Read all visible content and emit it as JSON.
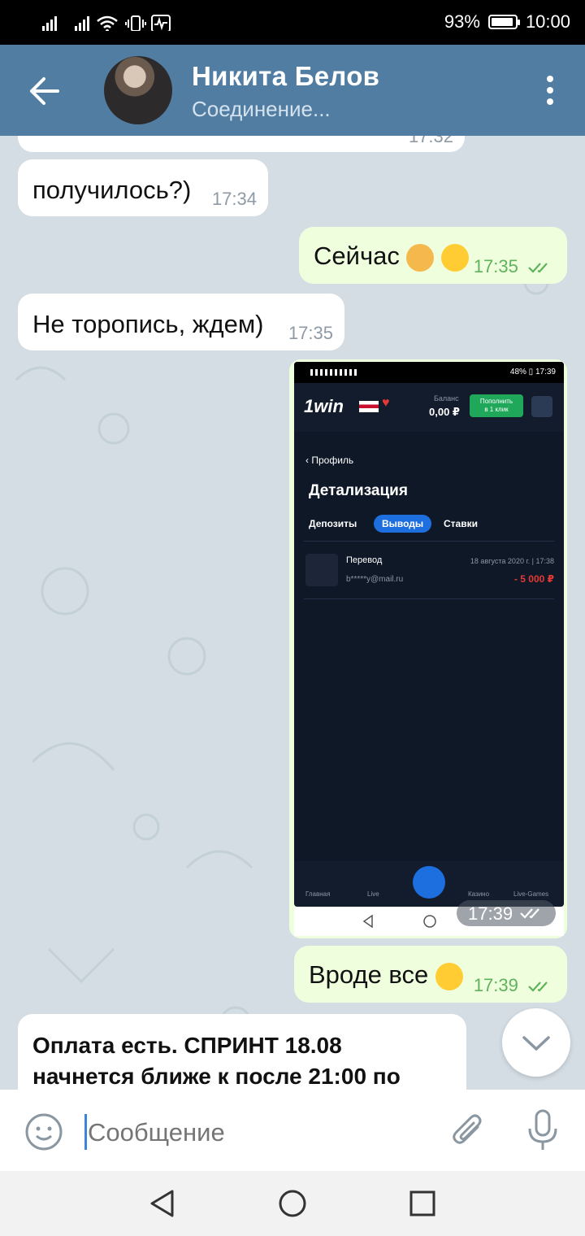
{
  "status_bar": {
    "battery": "93%",
    "battery_level": 0.93,
    "time": "10:00"
  },
  "header": {
    "name": "Никита Белов",
    "status": "Соединение..."
  },
  "messages": [
    {
      "side": "in",
      "text": "",
      "time": "17:32"
    },
    {
      "side": "in",
      "text": "получилось?)",
      "time": "17:34"
    },
    {
      "side": "out",
      "text": "Сейчас",
      "time": "17:35"
    },
    {
      "side": "in",
      "text": "Не торопись, ждем)",
      "time": "17:35"
    },
    {
      "side": "out",
      "text": "",
      "time": "17:39"
    },
    {
      "side": "out",
      "text": "Вроде все",
      "time": "17:39"
    },
    {
      "side": "in",
      "text_line1": "Оплата есть. СПРИНТ  18.08",
      "text_line2": "начнется ближе к после 21:00 по"
    }
  ],
  "shared_screenshot": {
    "status_left": "",
    "status_right": "48% ▯ 17:39",
    "logo": "1win",
    "balance_label": "Баланс",
    "balance_value": "0,00 ₽",
    "deposit_button": "Пополнить\nв 1 клик",
    "breadcrumb": "Профиль",
    "title": "Детализация",
    "tabs": [
      "Депозиты",
      "Выводы",
      "Ставки"
    ],
    "row": {
      "title": "Перевод",
      "email": "b*****y@mail.ru",
      "date": "18 августа 2020 г. | 17:38",
      "amount": "- 5 000 ₽"
    },
    "nav": [
      "Главная",
      "Live",
      "",
      "Казино",
      "Live-Games"
    ]
  },
  "input": {
    "placeholder": "Сообщение"
  },
  "colors": {
    "header": "#527da3",
    "out_bubble": "#efffde",
    "in_bubble": "#ffffff",
    "chat_bg": "#d3dde3"
  }
}
